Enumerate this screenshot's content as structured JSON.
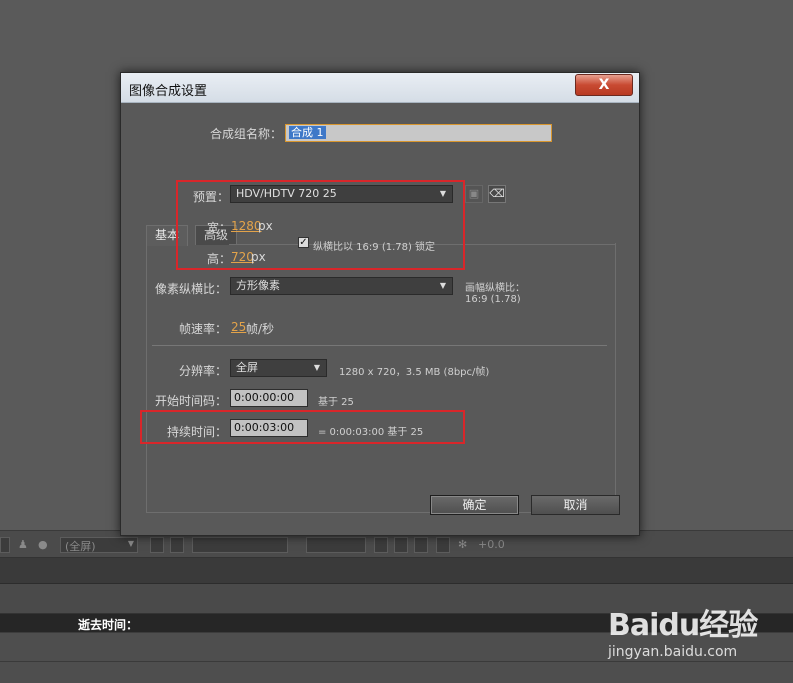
{
  "dialog": {
    "title": "图像合成设置",
    "close_label": "X",
    "name_label": "合成组名称：",
    "name_value": "合成 1",
    "tabs": [
      {
        "label": "基本"
      },
      {
        "label": "高级"
      }
    ],
    "preset_label": "预置：",
    "preset_value": "HDV/HDTV 720 25",
    "width_label": "宽：",
    "width_value": "1280",
    "width_unit": "px",
    "height_label": "高：",
    "height_value": "720",
    "height_unit": "px",
    "lock_aspect_label": "纵横比以 16:9 (1.78) 锁定",
    "pixel_aspect_label": "像素纵横比：",
    "pixel_aspect_value": "方形像素",
    "frame_aspect_label": "画幅纵横比：",
    "frame_aspect_value": "16:9 (1.78)",
    "framerate_label": "帧速率：",
    "framerate_value": "25",
    "framerate_unit": "帧/秒",
    "resolution_label": "分辨率：",
    "resolution_value": "全屏",
    "resolution_info": "1280 x 720，3.5 MB (8bpc/帧)",
    "start_tc_label": "开始时间码：",
    "start_tc_value": "0:00:00:00",
    "start_tc_base": "基于 25",
    "duration_label": "持续时间：",
    "duration_value": "0:00:03:00",
    "duration_info": "= 0:00:03:00  基于 25",
    "ok_label": "确定",
    "cancel_label": "取消"
  },
  "background": {
    "resolution_dropdown": "(全屏)",
    "zoom_value": "+0.0",
    "elapsed_time_label": "逝去时间："
  },
  "watermark": {
    "logo": "Baidu经验",
    "url": "jingyan.baidu.com"
  },
  "colors": {
    "accent_orange": "#e3a34a",
    "highlight_red": "#d9262a",
    "selection_blue": "#3e78c8"
  }
}
